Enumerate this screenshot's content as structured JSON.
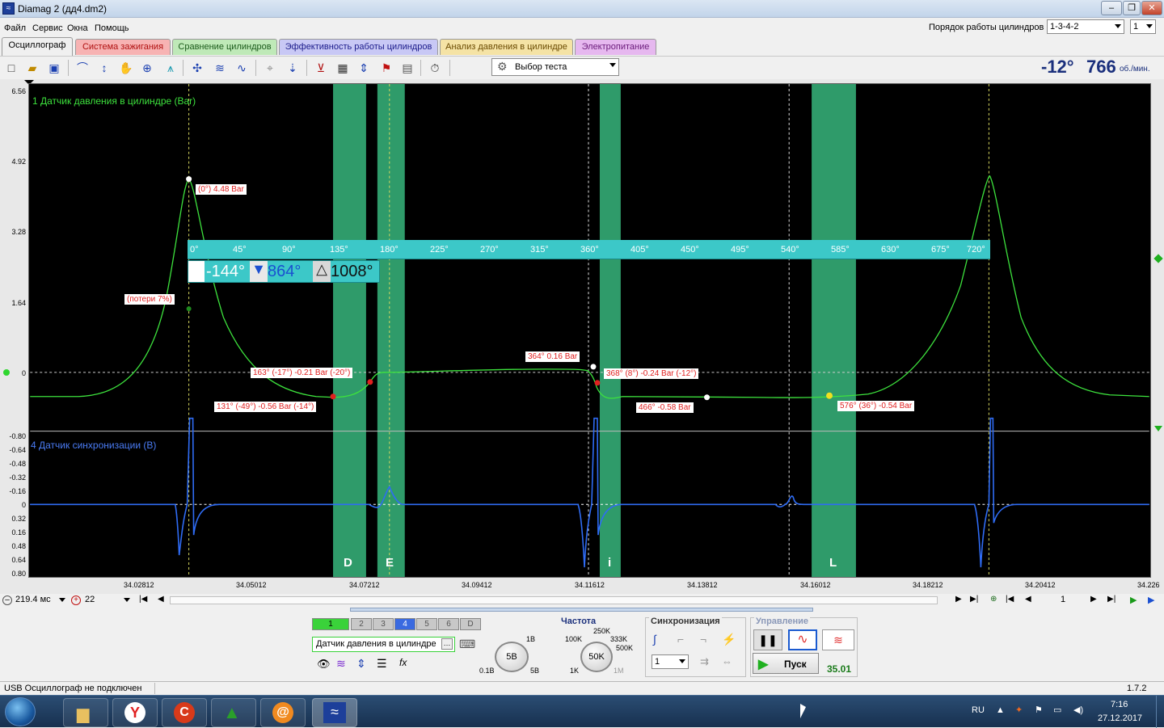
{
  "window": {
    "title": "Diamag 2 (дд4.dm2)",
    "app_icon": "diamag-logo-icon"
  },
  "menu": {
    "items": [
      "Файл",
      "Сервис",
      "Окна",
      "Помощь"
    ]
  },
  "cylinder_order": {
    "label": "Порядок работы цилиндров",
    "value": "1-3-4-2",
    "count": "1"
  },
  "tabs": [
    {
      "label": "Осциллограф",
      "color": "#f0f0f0",
      "active": true
    },
    {
      "label": "Система зажигания",
      "color": "#f7b3b3"
    },
    {
      "label": "Сравнение цилиндров",
      "color": "#bfe9b8"
    },
    {
      "label": "Эффективность работы цилиндров",
      "color": "#c8c8f5"
    },
    {
      "label": "Анализ давления в цилиндре",
      "color": "#f5e3a5"
    },
    {
      "label": "Электропитание",
      "color": "#e6b8ef"
    }
  ],
  "toolbar": {
    "test_select": "Выбор теста",
    "angle": "-12°",
    "rpm": "766",
    "rpm_unit": "об./мин."
  },
  "scope": {
    "channel1_label": "1 Датчик давления в цилиндре (Bar)",
    "channel4_label": "4 Датчик синхронизации (В)",
    "y_ticks_ch1": [
      "6.56",
      "4.92",
      "3.28",
      "1.64",
      "0"
    ],
    "y_ticks_ch4": [
      "-0.80",
      "-0.64",
      "-0.48",
      "-0.32",
      "-0.16",
      "0",
      "0.16",
      "0.32",
      "0.48",
      "0.64",
      "0.80"
    ],
    "x_ticks": [
      "34.02812",
      "34.05012",
      "34.07212",
      "34.09412",
      "34.11612",
      "34.13812",
      "34.16012",
      "34.18212",
      "34.20412",
      "34.226"
    ],
    "degree_scale": [
      "0°",
      "45°",
      "90°",
      "135°",
      "180°",
      "225°",
      "270°",
      "315°",
      "360°",
      "405°",
      "450°",
      "495°",
      "540°",
      "585°",
      "630°",
      "675°",
      "720°"
    ],
    "cursor_start": "-144°",
    "cursor_end": "864°",
    "cursor_delta": "1008°",
    "zone_labels": [
      "D",
      "E",
      "i",
      "L"
    ],
    "annotations": [
      "(0°) 4.48 Bar",
      "(потери 7%)",
      "163° (-17°) -0.21 Bar (-20°)",
      "131° (-49°) -0.56 Bar (-14°)",
      "364° 0.16 Bar",
      "368° (8°) -0.24 Bar (-12°)",
      "466° -0.58 Bar",
      "576° (36°) -0.54 Bar"
    ],
    "trace_colors": {
      "pressure": "#3de23d",
      "sync": "#2f6cf5",
      "zone": "#2f9b6a"
    }
  },
  "nav": {
    "timebase": "219.4 мс",
    "zoom": "22",
    "page": "1"
  },
  "control": {
    "channels": [
      "1",
      "2",
      "3",
      "4",
      "5",
      "6",
      "D"
    ],
    "channel_name": "Датчик давления в цилиндре",
    "scale_knob": "5В",
    "scale_marks": [
      "1В",
      "0.1В",
      "5В"
    ],
    "freq_label": "Частота",
    "freq_knob": "50K",
    "freq_marks": [
      "250K",
      "100K",
      "333K",
      "500K",
      "1K",
      "1M"
    ],
    "sync_label": "Синхронизация",
    "sync_channel": "1",
    "control_label": "Управление",
    "start_button": "Пуск",
    "value": "35.01"
  },
  "status": {
    "text": "USB Осциллограф не подключен",
    "version": "1.7.2"
  },
  "taskbar": {
    "lang": "RU",
    "time": "7:16",
    "date": "27.12.2017"
  }
}
